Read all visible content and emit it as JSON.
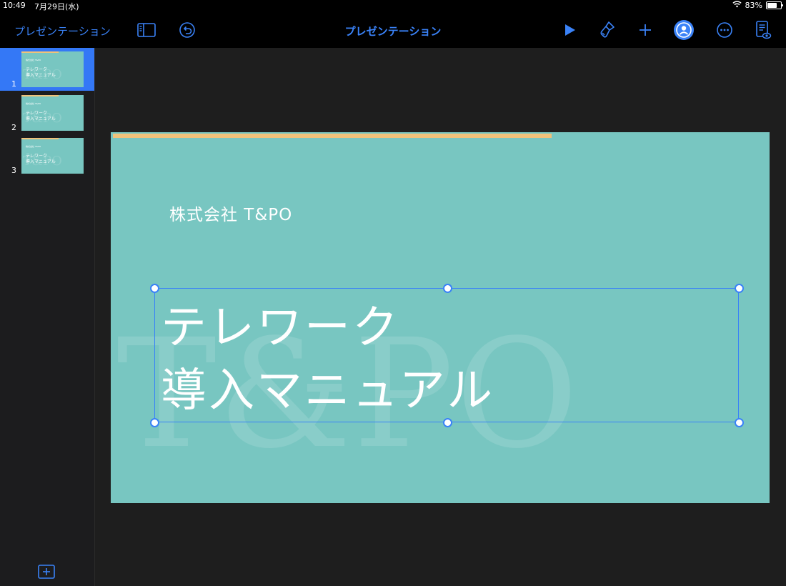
{
  "status_bar": {
    "time": "10:49",
    "date": "7月29日(水)",
    "battery": "83%",
    "battery_level": 0.83
  },
  "toolbar": {
    "back_label": "プレゼンテーション",
    "title": "プレゼンテーション"
  },
  "sidebar": {
    "slides": [
      {
        "number": "1",
        "selected": true
      },
      {
        "number": "2",
        "selected": false
      },
      {
        "number": "3",
        "selected": false
      }
    ]
  },
  "slide": {
    "company": "株式会社 T&PO",
    "title_line1": "テレワーク",
    "title_line2": "導入マニュアル",
    "watermark": "T&PO",
    "accent_color": "#f0c27a",
    "background_color": "#78c6c1"
  },
  "thumbnail": {
    "small_text": "株式会社 T&PO",
    "title_line1": "テレワーク",
    "title_line2": "導入マニュアル",
    "watermark": "T&PO"
  },
  "colors": {
    "accent": "#3a82f7",
    "selected_row": "#3478f6"
  },
  "icons": [
    "sidebar-toggle-icon",
    "undo-icon",
    "play-icon",
    "paintbrush-icon",
    "plus-icon",
    "collaborate-icon",
    "more-icon",
    "presenter-notes-icon",
    "add-slide-icon",
    "wifi-icon",
    "battery-icon"
  ]
}
